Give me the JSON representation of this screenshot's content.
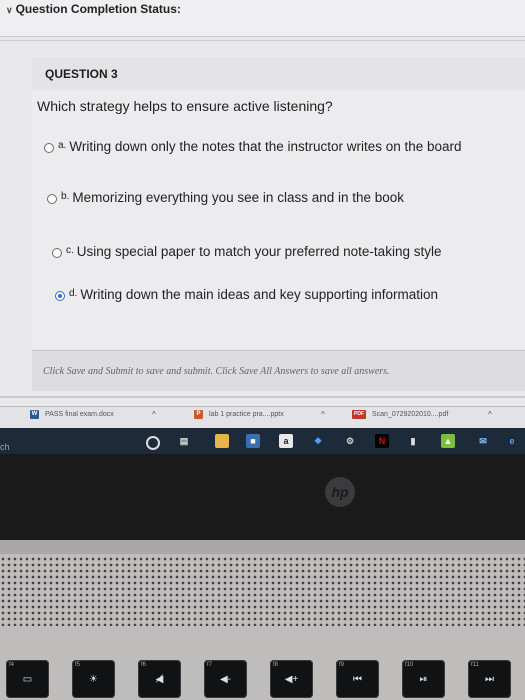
{
  "status": {
    "caret": "∨",
    "title": "Question Completion Status:"
  },
  "question": {
    "number_label": "QUESTION 3",
    "text": "Which strategy helps to ensure active listening?",
    "options": [
      {
        "letter": "a.",
        "text": "Writing down only the notes that the instructor writes on the board",
        "selected": false
      },
      {
        "letter": "b.",
        "text": "Memorizing everything you see in class and in the book",
        "selected": false
      },
      {
        "letter": "c.",
        "text": "Using special paper to match your preferred note-taking style",
        "selected": false
      },
      {
        "letter": "d.",
        "text": "Writing down the main ideas and key supporting information",
        "selected": true
      }
    ]
  },
  "submit_hint": "Click Save and Submit to save and submit. Click Save All Answers to save all answers.",
  "downloads": [
    {
      "name": "PASS final exam.docx",
      "badge": "W",
      "color": "#2b5797"
    },
    {
      "name": "lab 1 practice pra....pptx",
      "badge": "P",
      "color": "#c75b2a"
    },
    {
      "name": "Scan_0729202010....pdf",
      "badge": "PDF",
      "color": "#c0392b"
    }
  ],
  "taskbar": {
    "left_text": "ch",
    "icons": [
      "search-circle-icon",
      "task-view-icon",
      "file-explorer-icon",
      "store-icon",
      "amazon-icon",
      "dropbox-icon",
      "settings-icon",
      "netflix-icon",
      "media-icon",
      "photos-icon",
      "mail-icon",
      "edge-icon"
    ]
  },
  "brand": "hp",
  "keys": [
    {
      "fn": "f4",
      "glyph": "▭"
    },
    {
      "fn": "f5",
      "glyph": "☀"
    },
    {
      "fn": "f6",
      "glyph": "◀̸"
    },
    {
      "fn": "f7",
      "glyph": "◀-"
    },
    {
      "fn": "f8",
      "glyph": "◀+"
    },
    {
      "fn": "f9",
      "glyph": "⏮"
    },
    {
      "fn": "f10",
      "glyph": "⏯"
    },
    {
      "fn": "f11",
      "glyph": "⏭"
    }
  ]
}
